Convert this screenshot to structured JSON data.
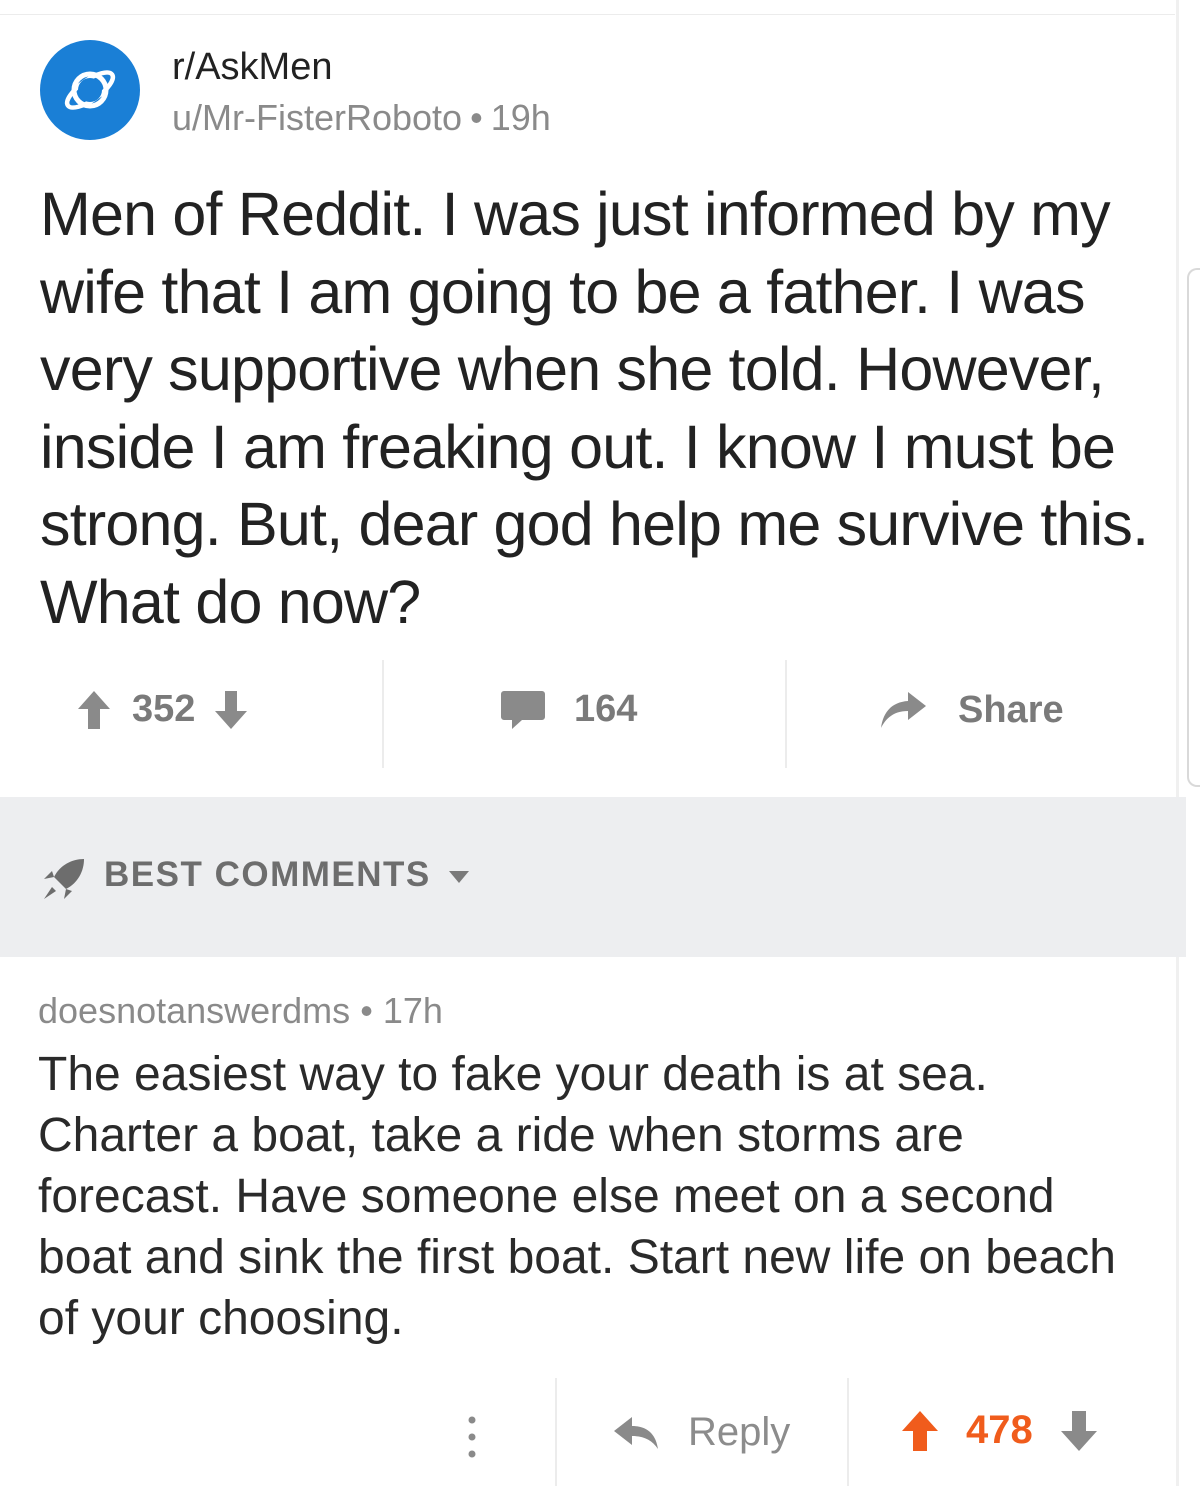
{
  "post": {
    "subreddit": "r/AskMen",
    "author": "u/Mr-FisterRoboto",
    "separator": "•",
    "age": "19h",
    "title": "Men of Reddit. I was just informed by my wife that I am going to be a father. I was very supportive when she told. However, inside I am freaking out. I know I must be strong. But, dear god help me survive this. What do now?",
    "score": "352",
    "comments": "164",
    "share_label": "Share"
  },
  "comments_section": {
    "sort_label": "BEST COMMENTS"
  },
  "comment": {
    "author": "doesnotanswerdms",
    "separator": "•",
    "age": "17h",
    "body": "The easiest way to fake your death is at sea. Charter a boat, take a ride when storms are forecast. Have someone else meet on a second boat and sink the first boat. Start new life on beach of your choosing.",
    "reply_label": "Reply",
    "score": "478"
  },
  "colors": {
    "subreddit_icon": "#1a7fd6",
    "upvoted": "#f05c1c",
    "muted": "#7a7a7a",
    "section_bg": "#edeef0"
  },
  "icons": [
    "planet-icon",
    "upvote-icon",
    "downvote-icon",
    "comment-bubble-icon",
    "share-arrow-icon",
    "rocket-icon",
    "chevron-down-icon",
    "more-dots-icon",
    "reply-arrow-icon"
  ]
}
